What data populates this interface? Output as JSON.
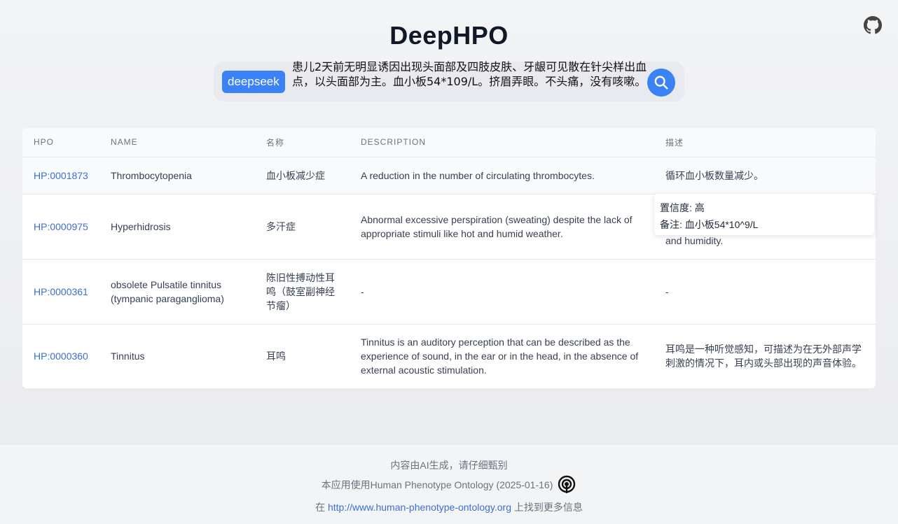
{
  "header": {
    "title": "DeepHPO"
  },
  "search": {
    "model": "deepseek",
    "query": "患儿2天前无明显诱因出现头面部及四肢皮肤、牙龈可见散在针尖样出血点，以头面部为主。血小板54*109/L。挤眉弄眼。不头痛，没有咳嗽。"
  },
  "table": {
    "columns": [
      "HPO",
      "NAME",
      "名称",
      "DESCRIPTION",
      "描述"
    ],
    "rows": [
      {
        "hpo": "HP:0001873",
        "name": "Thrombocytopenia",
        "name_cn": "血小板减少症",
        "description": "A reduction in the number of circulating thrombocytes.",
        "description_cn": "循环血小板数量减少。"
      },
      {
        "hpo": "HP:0000975",
        "name": "Hyperhidrosis",
        "name_cn": "多汗症",
        "description": "Abnormal excessive perspiration (sweating) despite the lack of appropriate stimuli like hot and humid weather.",
        "description_cn": "and humidity."
      },
      {
        "hpo": "HP:0000361",
        "name": "obsolete Pulsatile tinnitus (tympanic paraganglioma)",
        "name_cn": "陈旧性搏动性耳鸣（鼓室副神经节瘤）",
        "description": "-",
        "description_cn": "-"
      },
      {
        "hpo": "HP:0000360",
        "name": "Tinnitus",
        "name_cn": "耳鸣",
        "description": "Tinnitus is an auditory perception that can be described as the experience of sound, in the ear or in the head, in the absence of external acoustic stimulation.",
        "description_cn": "耳鸣是一种听觉感知，可描述为在无外部声学刺激的情况下，耳内或头部出现的声音体验。"
      }
    ]
  },
  "tooltip": {
    "confidence": "置信度: 高",
    "note": "备注: 血小板54*10^9/L"
  },
  "footer": {
    "disclaimer": "内容由AI生成，请仔细甄别",
    "ontology": "本应用使用Human Phenotype Ontology (2025-01-16)",
    "more_prefix": "在",
    "link": "http://www.human-phenotype-ontology.org",
    "more_suffix": "上找到更多信息"
  },
  "colors": {
    "accent": "#3b82f6",
    "link": "#3b6fd4"
  }
}
